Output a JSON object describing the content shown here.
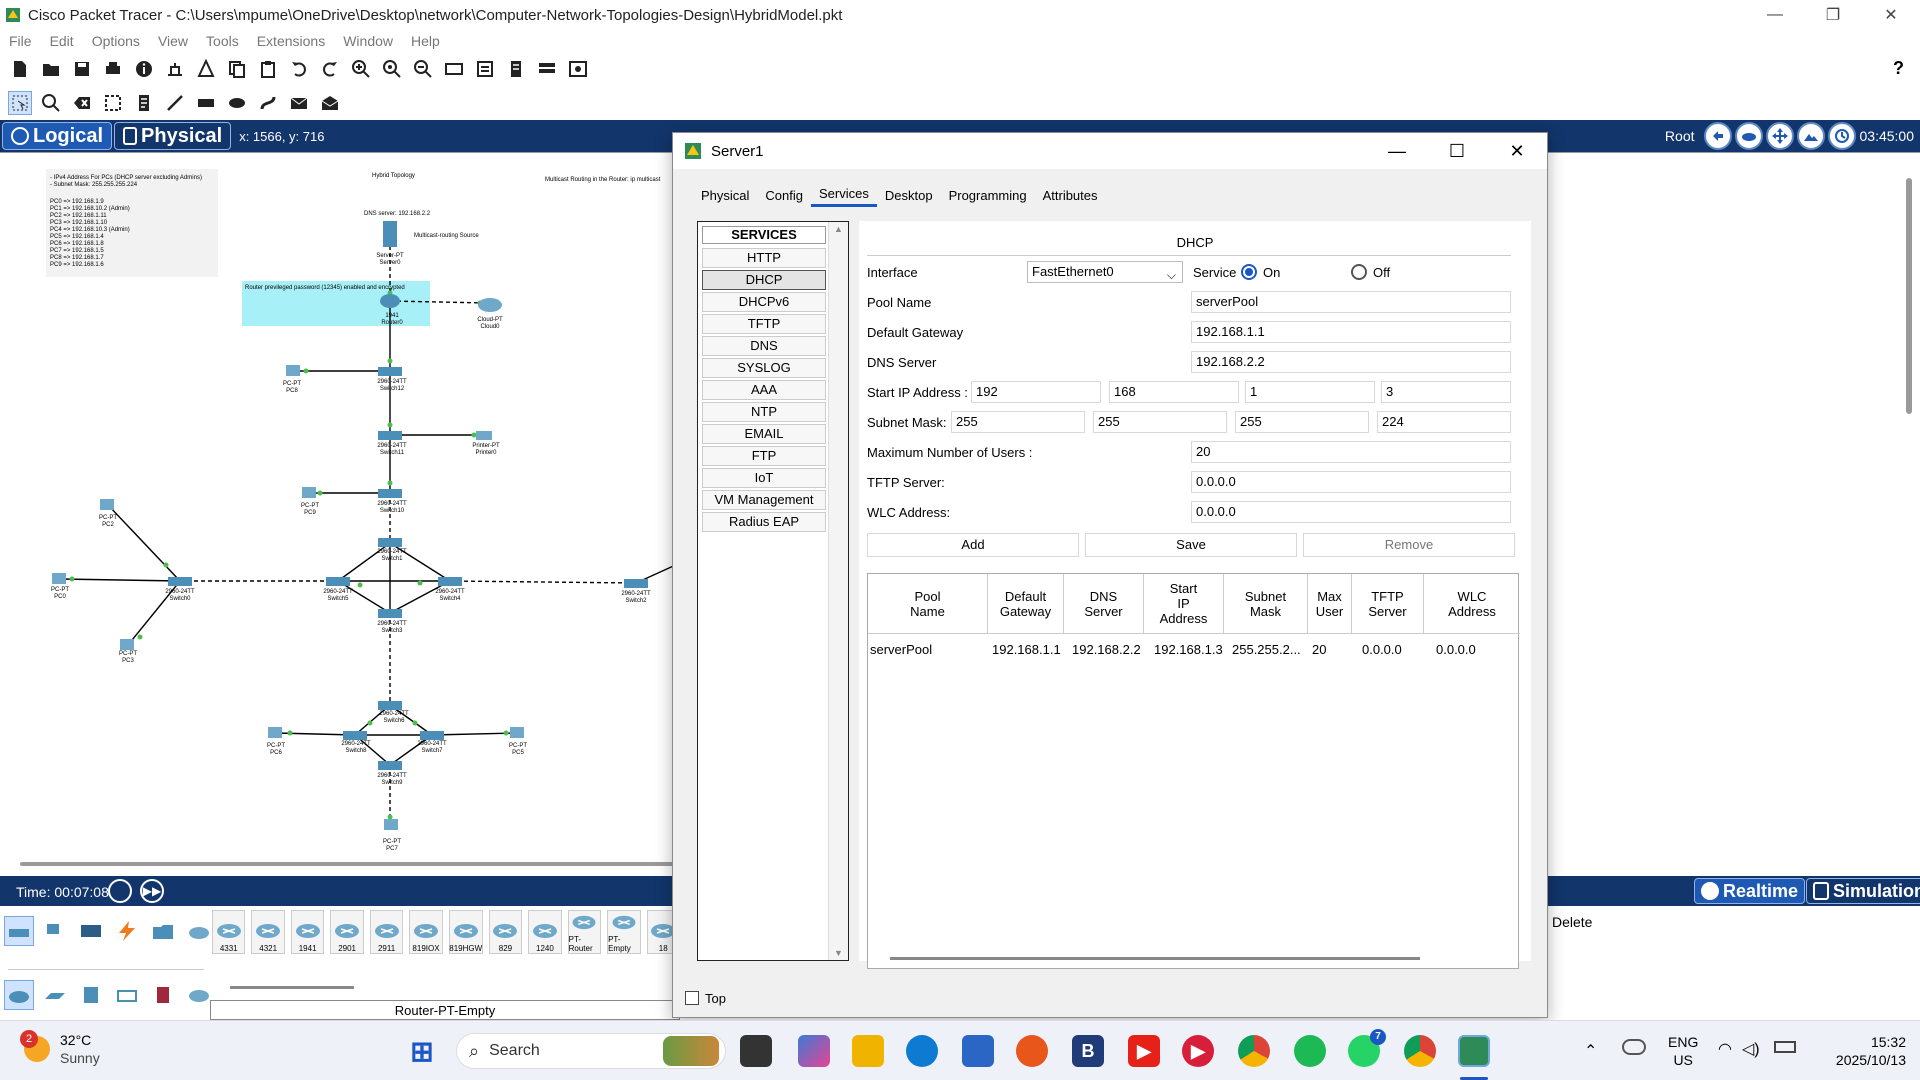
{
  "window": {
    "title": "Cisco Packet Tracer - C:\\Users\\mpume\\OneDrive\\Desktop\\network\\Computer-Network-Topologies-Design\\HybridModel.pkt",
    "minimize": "—",
    "restore": "❐",
    "close": "✕"
  },
  "menu": [
    "File",
    "Edit",
    "Options",
    "View",
    "Tools",
    "Extensions",
    "Window",
    "Help"
  ],
  "toolbar1_help": "?",
  "navbar": {
    "logical": "Logical",
    "physical": "Physical",
    "coords": "x: 1566, y: 716",
    "root": "Root",
    "clock": "03:45:00"
  },
  "workspace": {
    "notes_left": [
      "- IPv4 Address For PCs (DHCP server excluding Admins)",
      "- Subnet Mask: 255.255.255.224",
      "PC0 => 192.168.1.9",
      "PC1 => 192.168.10.2 (Admin)",
      "PC2 => 192.168.1.11",
      "PC3 => 192.168.1.10",
      "PC4 => 192.168.10.3 (Admin)",
      "PC5 => 192.168.1.4",
      "PC6 => 192.168.1.8",
      "PC7 => 192.168.1.5",
      "PC8 => 192.168.1.7",
      "PC9 => 192.168.1.6"
    ],
    "hybrid_title": "Hybrid Topology",
    "multicast_note": "Multicast Routing in the Router: ip multicast",
    "dns_label": "DNS server: 192.168.2.2",
    "multicast_source": "Multicast-routing Source",
    "router_note": "Router previleged password (12345) enabled and encrypted",
    "devices": [
      {
        "id": "server0",
        "label": "Server-PT\nServer0"
      },
      {
        "id": "router0",
        "label": "1941\nRouter0"
      },
      {
        "id": "cloud0",
        "label": "Cloud-PT\nCloud0"
      },
      {
        "id": "switch12",
        "label": "2960-24TT\nSwitch12"
      },
      {
        "id": "pc8",
        "label": "PC-PT\nPC8"
      },
      {
        "id": "switch11",
        "label": "2960-24TT\nSwitch11"
      },
      {
        "id": "printer0",
        "label": "Printer-PT\nPrinter0"
      },
      {
        "id": "pc9",
        "label": "PC-PT\nPC9"
      },
      {
        "id": "switch10",
        "label": "2960-24TT\nSwitch10"
      },
      {
        "id": "pc2",
        "label": "PC-PT\nPC2"
      },
      {
        "id": "switch1",
        "label": "2960-24TT\nSwitch1"
      },
      {
        "id": "pc0",
        "label": "PC-PT\nPC0"
      },
      {
        "id": "switch0",
        "label": "2960-24TT\nSwitch0"
      },
      {
        "id": "switch5",
        "label": "2960-24TT\nSwitch5"
      },
      {
        "id": "switch4",
        "label": "2960-24TT\nSwitch4"
      },
      {
        "id": "switch2",
        "label": "2960-24TT\nSwitch2"
      },
      {
        "id": "pc3",
        "label": "PC-PT\nPC3"
      },
      {
        "id": "switch3",
        "label": "2960-24TT\nSwitch3"
      },
      {
        "id": "switch6",
        "label": "2960-24TT\nSwitch6"
      },
      {
        "id": "pc6",
        "label": "PC-PT\nPC6"
      },
      {
        "id": "switch8",
        "label": "2960-24TT\nSwitch8"
      },
      {
        "id": "switch7",
        "label": "2960-24TT\nSwitch7"
      },
      {
        "id": "pc5",
        "label": "PC-PT\nPC5"
      },
      {
        "id": "switch9",
        "label": "2960-24TT\nSwitch9"
      },
      {
        "id": "pc7",
        "label": "PC-PT\nPC7"
      }
    ]
  },
  "bottombar": {
    "time": "Time: 00:07:08",
    "realtime": "Realtime",
    "simulation": "Simulation"
  },
  "device_models": [
    "4331",
    "4321",
    "1941",
    "2901",
    "2911",
    "819IOX",
    "819HGW",
    "829",
    "1240",
    "PT-Router",
    "PT-Empty",
    "18"
  ],
  "selected_device": "Router-PT-Empty",
  "delete_label": "Delete",
  "dialog": {
    "title": "Server1",
    "tabs": [
      "Physical",
      "Config",
      "Services",
      "Desktop",
      "Programming",
      "Attributes"
    ],
    "active_tab": "Services",
    "services_header": "SERVICES",
    "services": [
      "HTTP",
      "DHCP",
      "DHCPv6",
      "TFTP",
      "DNS",
      "SYSLOG",
      "AAA",
      "NTP",
      "EMAIL",
      "FTP",
      "IoT",
      "VM Management",
      "Radius EAP"
    ],
    "active_service": "DHCP",
    "top_label": "Top",
    "dhcp": {
      "title": "DHCP",
      "interface_label": "Interface",
      "interface_value": "FastEthernet0",
      "service_label": "Service",
      "on_label": "On",
      "off_label": "Off",
      "service_state": "On",
      "pool_name_label": "Pool Name",
      "pool_name": "serverPool",
      "gateway_label": "Default Gateway",
      "gateway": "192.168.1.1",
      "dns_label": "DNS Server",
      "dns": "192.168.2.2",
      "start_ip_label": "Start IP Address :",
      "start_ip": [
        "192",
        "168",
        "1",
        "3"
      ],
      "subnet_label": "Subnet Mask:",
      "subnet": [
        "255",
        "255",
        "255",
        "224"
      ],
      "max_users_label": "Maximum Number of Users :",
      "max_users": "20",
      "tftp_label": "TFTP Server:",
      "tftp": "0.0.0.0",
      "wlc_label": "WLC Address:",
      "wlc": "0.0.0.0",
      "add": "Add",
      "save": "Save",
      "remove": "Remove",
      "table_headers": [
        "Pool\nName",
        "Default\nGateway",
        "DNS\nServer",
        "Start\nIP\nAddress",
        "Subnet\nMask",
        "Max\nUser",
        "TFTP\nServer",
        "WLC\nAddress"
      ],
      "table_rows": [
        [
          "serverPool",
          "192.168.1.1",
          "192.168.2.2",
          "192.168.1.3",
          "255.255.2...",
          "20",
          "0.0.0.0",
          "0.0.0.0"
        ]
      ]
    }
  },
  "taskbar": {
    "weather_badge": "2",
    "temperature": "32°C",
    "condition": "Sunny",
    "search": "Search",
    "whatsapp_badge": "7",
    "lang": "ENG",
    "region": "US",
    "time": "15:32",
    "date": "2025/10/13"
  },
  "colors": {
    "navbar": "#12356b",
    "accent": "#1a56c4",
    "link": "#58b858",
    "note_bg": "#a8f0f7"
  }
}
